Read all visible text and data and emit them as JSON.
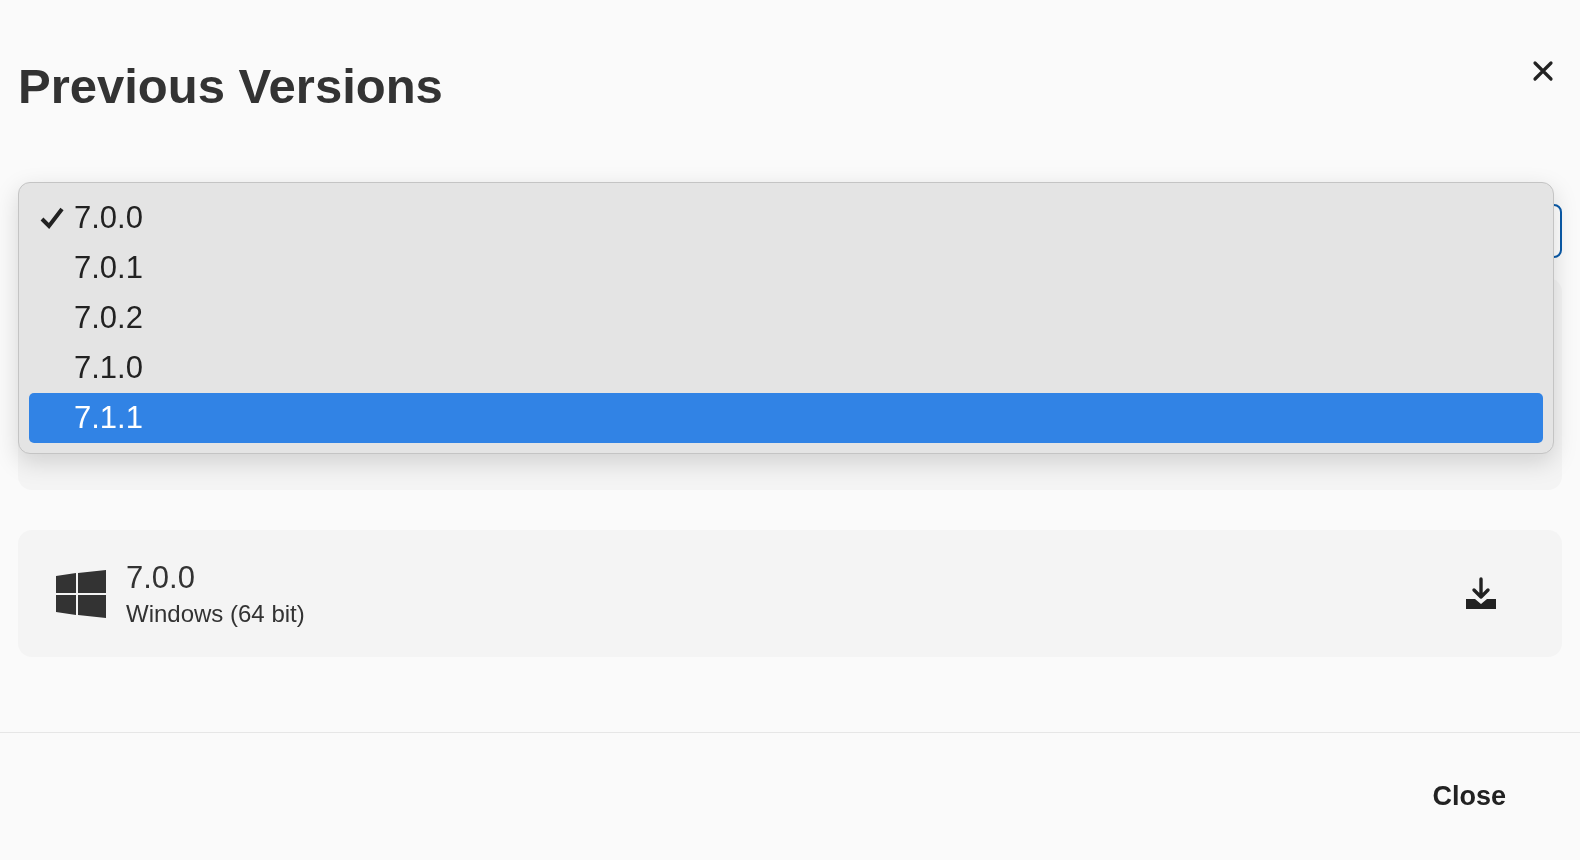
{
  "dialog": {
    "title": "Previous Versions"
  },
  "version_select": {
    "options": [
      {
        "label": "7.0.0",
        "checked": true,
        "selected": false
      },
      {
        "label": "7.0.1",
        "checked": false,
        "selected": false
      },
      {
        "label": "7.0.2",
        "checked": false,
        "selected": false
      },
      {
        "label": "7.1.0",
        "checked": false,
        "selected": false
      },
      {
        "label": "7.1.1",
        "checked": false,
        "selected": true
      }
    ]
  },
  "downloads": [
    {
      "kind": "covered"
    },
    {
      "kind": "windows",
      "version": "7.0.0",
      "platform": "Windows (64 bit)"
    }
  ],
  "footer": {
    "button": "Close"
  }
}
